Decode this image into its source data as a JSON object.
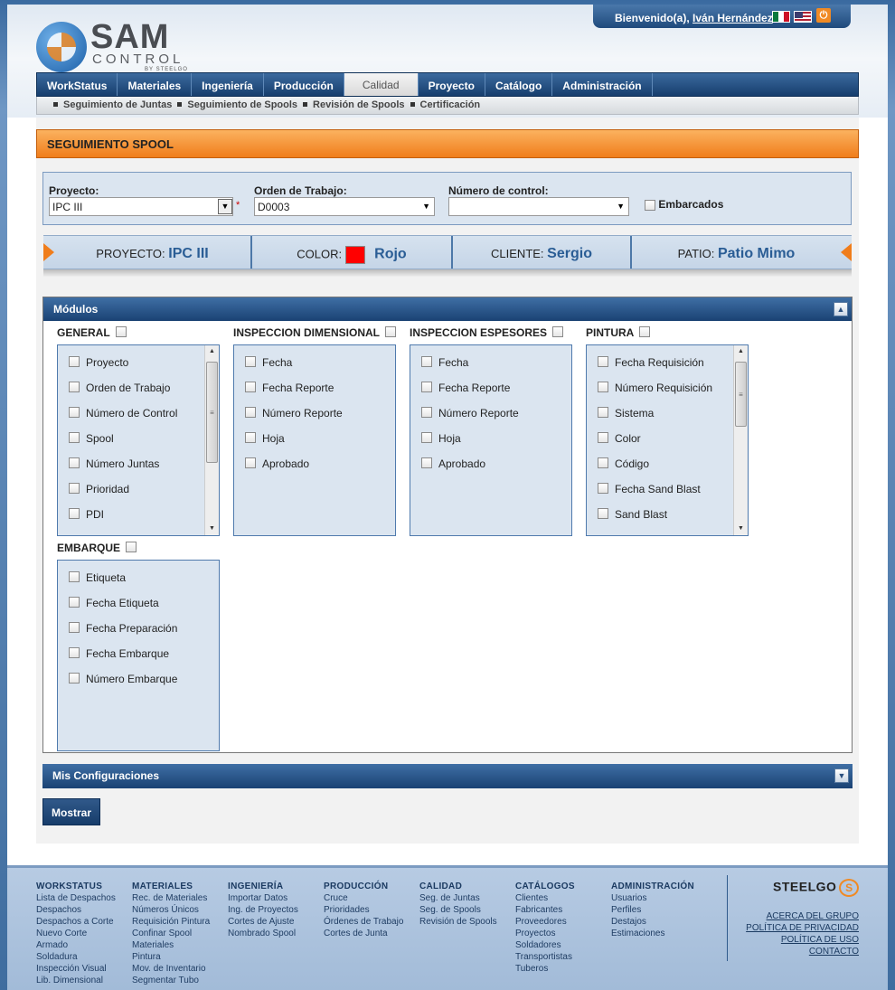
{
  "header": {
    "logo_sam": "SAM",
    "logo_control": "CONTROL",
    "logo_by": "BY STEELGO",
    "welcome_text": "Bienvenido(a),",
    "user_name": "Iván Hernández"
  },
  "nav": {
    "items": [
      "WorkStatus",
      "Materiales",
      "Ingeniería",
      "Producción",
      "Calidad",
      "Proyecto",
      "Catálogo",
      "Administración"
    ],
    "active": "Calidad"
  },
  "subnav": [
    "Seguimiento de Juntas",
    "Seguimiento de Spools",
    "Revisión de Spools",
    "Certificación"
  ],
  "page_title": "SEGUIMIENTO SPOOL",
  "filters": {
    "proyecto_label": "Proyecto:",
    "proyecto_value": "IPC III",
    "orden_label": "Orden de Trabajo:",
    "orden_value": "D0003",
    "control_label": "Número de control:",
    "control_value": "",
    "embarcados_label": "Embarcados",
    "required_mark": "*"
  },
  "infobar": {
    "proyecto_label": "PROYECTO:",
    "proyecto_value": "IPC III",
    "color_label": "COLOR:",
    "color_value": "Rojo",
    "color_hex": "#ff0000",
    "cliente_label": "CLIENTE:",
    "cliente_value": "Sergio",
    "patio_label": "PATIO:",
    "patio_value": "Patio Mimo"
  },
  "modules": {
    "title": "Módulos",
    "groups": [
      {
        "title": "GENERAL",
        "options": [
          "Proyecto",
          "Orden de Trabajo",
          "Número de Control",
          "Spool",
          "Número Juntas",
          "Prioridad",
          "PDI"
        ]
      },
      {
        "title": "INSPECCION DIMENSIONAL",
        "options": [
          "Fecha",
          "Fecha Reporte",
          "Número Reporte",
          "Hoja",
          "Aprobado"
        ]
      },
      {
        "title": "INSPECCION ESPESORES",
        "options": [
          "Fecha",
          "Fecha Reporte",
          "Número Reporte",
          "Hoja",
          "Aprobado"
        ]
      },
      {
        "title": "PINTURA",
        "options": [
          "Fecha Requisición",
          "Número Requisición",
          "Sistema",
          "Color",
          "Código",
          "Fecha Sand Blast",
          "Sand Blast"
        ]
      },
      {
        "title": "EMBARQUE",
        "options": [
          "Etiqueta",
          "Fecha Etiqueta",
          "Fecha Preparación",
          "Fecha Embarque",
          "Número Embarque"
        ]
      }
    ]
  },
  "config_title": "Mis Configuraciones",
  "mostrar_label": "Mostrar",
  "footer": {
    "columns": [
      {
        "title": "WORKSTATUS",
        "links": [
          "Lista de Despachos",
          "Despachos",
          "Despachos a Corte",
          "Nuevo Corte",
          "Armado",
          "Soldadura",
          "Inspección Visual",
          "Lib. Dimensional"
        ]
      },
      {
        "title": "MATERIALES",
        "links": [
          "Rec. de Materiales",
          "Números Únicos",
          "Requisición Pintura",
          "Confinar Spool",
          "Materiales",
          "Pintura",
          "Mov. de Inventario",
          "Segmentar Tubo"
        ]
      },
      {
        "title": "INGENIERÍA",
        "links": [
          "Importar Datos",
          "Ing. de Proyectos",
          "Cortes de Ajuste",
          "Nombrado Spool"
        ]
      },
      {
        "title": "PRODUCCIÓN",
        "links": [
          "Cruce",
          "Prioridades",
          "Órdenes de Trabajo",
          "Cortes de Junta"
        ]
      },
      {
        "title": "CALIDAD",
        "links": [
          "Seg. de Juntas",
          "Seg. de Spools",
          "Revisión de Spools"
        ]
      },
      {
        "title": "CATÁLOGOS",
        "links": [
          "Clientes",
          "Fabricantes",
          "Proveedores",
          "Proyectos",
          "Soldadores",
          "Transportistas",
          "Tuberos"
        ]
      },
      {
        "title": "ADMINISTRACIÓN",
        "links": [
          "Usuarios",
          "Perfiles",
          "Destajos",
          "Estimaciones"
        ]
      }
    ],
    "brand": "STEELGO",
    "links": [
      "ACERCA DEL GRUPO",
      "POLÍTICA DE PRIVACIDAD",
      "POLÍTICA DE USO",
      "CONTACTO"
    ]
  }
}
